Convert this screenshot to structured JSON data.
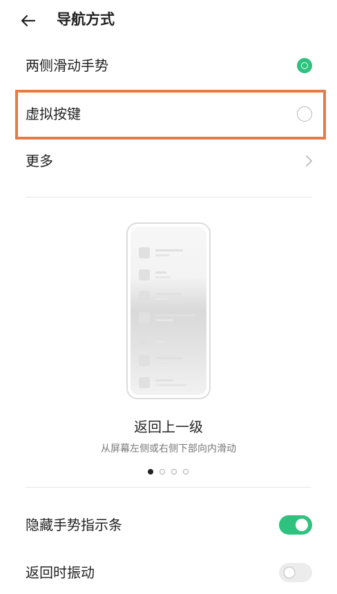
{
  "header": {
    "title": "导航方式",
    "back_icon": "arrow-left-icon"
  },
  "options": [
    {
      "label": "两侧滑动手势",
      "selected": true
    },
    {
      "label": "虚拟按键",
      "selected": false
    },
    {
      "label": "更多",
      "icon": "chevron-right-icon"
    }
  ],
  "colors": {
    "accent": "#2ec27e",
    "highlight": "#e27c48"
  },
  "illustration": {
    "title": "返回上一级",
    "subtitle": "从屏幕左侧或右侧下部向内滑动",
    "pager": {
      "count": 4,
      "active": 1
    }
  },
  "toggles": [
    {
      "label": "隐藏手势指示条",
      "on": true
    },
    {
      "label": "返回时振动",
      "on": false
    }
  ]
}
